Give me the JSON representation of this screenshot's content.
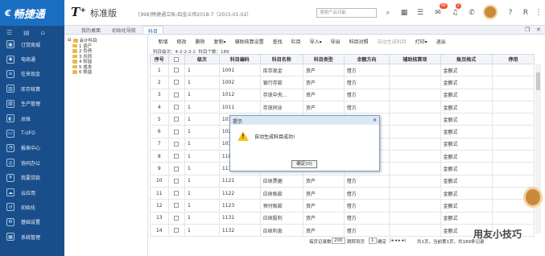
{
  "brand": {
    "icon": "€",
    "name": "畅捷通"
  },
  "product": {
    "t": "T⁺",
    "name": "标准版"
  },
  "account_info": "[998]畅捷通立账-四金义项2018-7（2015-01-02）",
  "search": {
    "placeholder": "搜索产品功能"
  },
  "top_icons": [
    "search-icon",
    "grid-icon",
    "ledger-icon",
    "message-icon",
    "bell-icon",
    "phone-icon",
    "avatar-icon",
    "help-icon",
    "user-icon"
  ],
  "badges": {
    "message": "99",
    "bell": "2"
  },
  "top_right_text": "R",
  "sidebar": {
    "top_icons": [
      "menu-icon",
      "list-icon",
      "home-icon"
    ],
    "items": [
      {
        "label": "订货商城",
        "icon": "shop-icon"
      },
      {
        "label": "电商通",
        "icon": "ecom-icon"
      },
      {
        "label": "往来现金",
        "icon": "cash-icon"
      },
      {
        "label": "库存核算",
        "icon": "stock-icon"
      },
      {
        "label": "生产管理",
        "icon": "factory-icon"
      },
      {
        "label": "总账",
        "icon": "ledger-icon"
      },
      {
        "label": "T-UFO",
        "icon": "report-icon"
      },
      {
        "label": "报表中心",
        "icon": "chart-icon"
      },
      {
        "label": "协同办公",
        "icon": "office-icon"
      },
      {
        "label": "我要贷款",
        "icon": "loan-icon"
      },
      {
        "label": "云应用",
        "icon": "cloud-icon"
      },
      {
        "label": "初始化",
        "icon": "init-icon"
      },
      {
        "label": "基础设置",
        "icon": "settings-icon"
      },
      {
        "label": "系统管理",
        "icon": "system-icon"
      }
    ]
  },
  "tabs": [
    "我的桌面",
    "初始化导航",
    "科目"
  ],
  "active_tab": 2,
  "tree": [
    "会计科目",
    "1 资产",
    "2 负债",
    "3 共同",
    "4 权益",
    "5 成本",
    "6 损益"
  ],
  "toolbar": [
    "新增",
    "修改",
    "删除",
    "复制▾",
    "辅助核算设置",
    "查找",
    "栏目",
    "导入▾",
    "导出",
    "科目对照",
    "自动生成科目",
    "打印▾",
    "退出"
  ],
  "levels": {
    "label": "科目级次：",
    "value": "4-2-2-2-2",
    "count_label": "科目个数：",
    "count": "189"
  },
  "grid": {
    "headers": [
      "序号",
      "",
      "级次",
      "科目编码",
      "科目名称",
      "科目类型",
      "余额方向",
      "辅助核算项",
      "账页格式",
      "停用"
    ],
    "rows": [
      [
        "1",
        "",
        "1",
        "1001",
        "库存现金",
        "资产",
        "借方",
        "",
        "金额式",
        ""
      ],
      [
        "2",
        "",
        "1",
        "1002",
        "银行存款",
        "资产",
        "借方",
        "",
        "金额式",
        ""
      ],
      [
        "3",
        "",
        "1",
        "1012",
        "存放中央...",
        "资产",
        "借方",
        "",
        "金额式",
        ""
      ],
      [
        "4",
        "",
        "1",
        "1011",
        "存放同业",
        "资产",
        "借方",
        "",
        "金额式",
        ""
      ],
      [
        "5",
        "",
        "1",
        "1012",
        "",
        "",
        "",
        "",
        "金额式",
        ""
      ],
      [
        "6",
        "",
        "1",
        "1021",
        "",
        "",
        "",
        "",
        "金额式",
        ""
      ],
      [
        "7",
        "",
        "1",
        "1031",
        "",
        "",
        "",
        "",
        "金额式",
        ""
      ],
      [
        "8",
        "",
        "1",
        "1101",
        "",
        "",
        "",
        "",
        "金额式",
        ""
      ],
      [
        "9",
        "",
        "1",
        "1111",
        "",
        "",
        "",
        "",
        "金额式",
        ""
      ],
      [
        "10",
        "",
        "1",
        "1121",
        "应收票据",
        "资产",
        "借方",
        "",
        "金额式",
        ""
      ],
      [
        "11",
        "",
        "1",
        "1122",
        "应收账款",
        "资产",
        "借方",
        "",
        "金额式",
        ""
      ],
      [
        "12",
        "",
        "1",
        "1123",
        "预付账款",
        "资产",
        "借方",
        "",
        "金额式",
        ""
      ],
      [
        "13",
        "",
        "1",
        "1131",
        "应收股利",
        "资产",
        "借方",
        "",
        "金额式",
        ""
      ],
      [
        "14",
        "",
        "1",
        "1132",
        "应收利息",
        "资产",
        "借方",
        "",
        "金额式",
        ""
      ]
    ]
  },
  "pager": {
    "rows_label": "每页记录数",
    "rows": "200",
    "goto_label": "跳转到页",
    "goto": "1",
    "page_label": "确定",
    "nav": "|◂ ◂ ▸ ▸|",
    "info": "共1页，当前第1页，共189条记录"
  },
  "dialog": {
    "title": "提示",
    "close": "×",
    "message": "自动生成科目成功!",
    "ok": "确定(O)"
  },
  "watermark": "用友小技巧"
}
